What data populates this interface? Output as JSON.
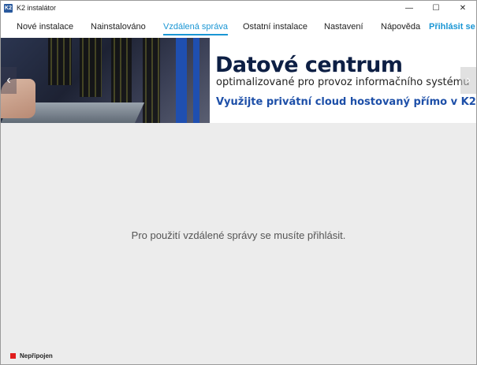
{
  "window": {
    "title": "K2 instalátor",
    "icon_label": "K2",
    "controls": {
      "minimize": "—",
      "maximize": "☐",
      "close": "✕"
    }
  },
  "nav": {
    "items": [
      {
        "label": "Nové instalace",
        "active": false
      },
      {
        "label": "Nainstalováno",
        "active": false
      },
      {
        "label": "Vzdálená správa",
        "active": true
      },
      {
        "label": "Ostatní instalace",
        "active": false
      },
      {
        "label": "Nastavení",
        "active": false
      },
      {
        "label": "Nápověda",
        "active": false
      }
    ],
    "login": "Přihlásit se",
    "accent_color": "#1a96d4"
  },
  "banner": {
    "title": "Datové centrum",
    "subtitle": "optimalizované pro provoz informačního systému",
    "cta": "Využijte privátní cloud hostovaný přímo v K2",
    "prev_arrow": "‹",
    "next_arrow": "›"
  },
  "main": {
    "message": "Pro použití vzdálené správy se musíte přihlásit."
  },
  "status": {
    "text": "Nepřipojen",
    "color": "#e01c1c"
  }
}
